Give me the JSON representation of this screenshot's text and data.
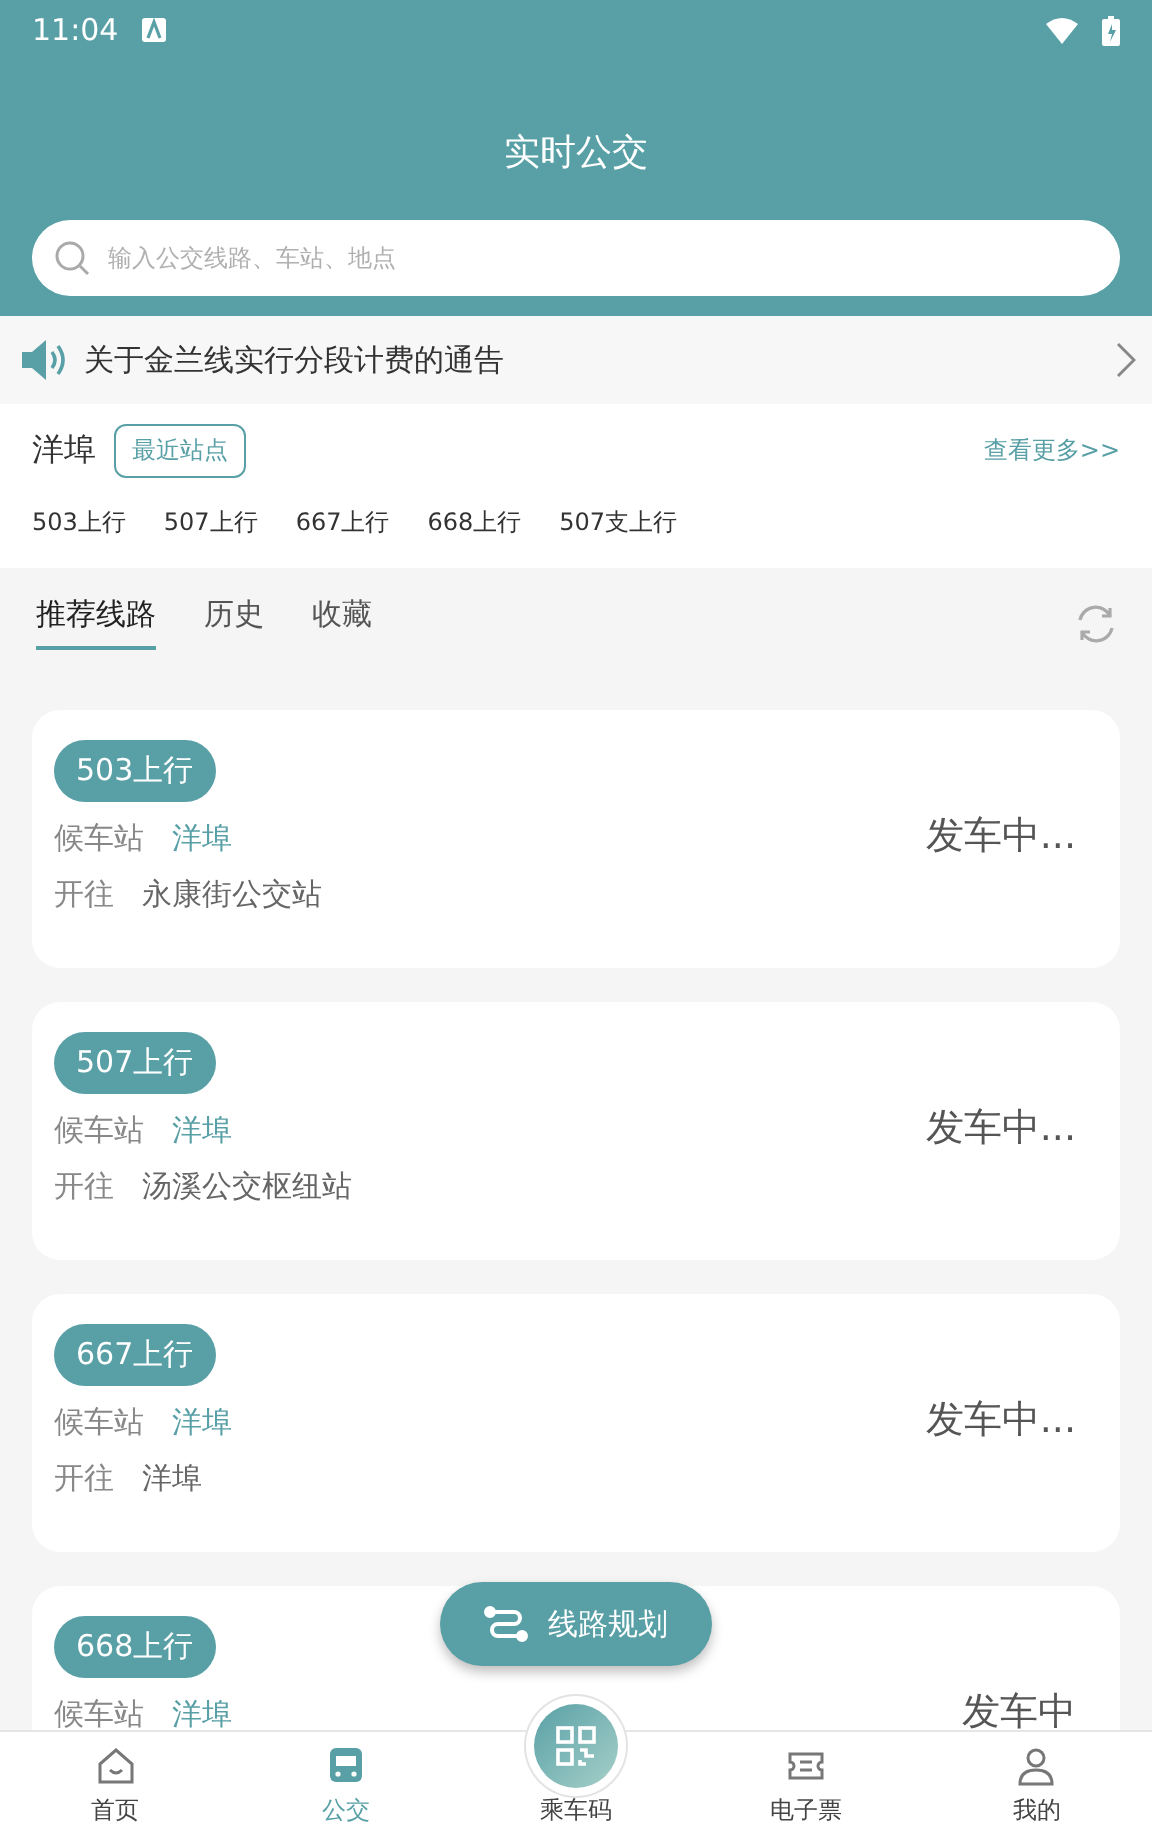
{
  "status_bar": {
    "time": "11:04"
  },
  "header": {
    "title": "实时公交",
    "search": {
      "placeholder": "输入公交线路、车站、地点"
    }
  },
  "notice": {
    "text": "关于金兰线实行分段计费的通告"
  },
  "nearby": {
    "station": "洋埠",
    "badge": "最近站点",
    "more": "查看更多>>",
    "routes": [
      "503上行",
      "507上行",
      "667上行",
      "668上行",
      "507支上行"
    ]
  },
  "tabs": [
    {
      "label": "推荐线路",
      "selected": true
    },
    {
      "label": "历史",
      "selected": false
    },
    {
      "label": "收藏",
      "selected": false
    }
  ],
  "cards": [
    {
      "route": "503上行",
      "wait_label": "候车站",
      "wait_station": "洋埠",
      "dest_label": "开往",
      "destination": "永康街公交站",
      "status": "发车中..."
    },
    {
      "route": "507上行",
      "wait_label": "候车站",
      "wait_station": "洋埠",
      "dest_label": "开往",
      "destination": "汤溪公交枢纽站",
      "status": "发车中..."
    },
    {
      "route": "667上行",
      "wait_label": "候车站",
      "wait_station": "洋埠",
      "dest_label": "开往",
      "destination": "洋埠",
      "status": "发车中..."
    },
    {
      "route": "668上行",
      "wait_label": "候车站",
      "wait_station": "洋埠",
      "status": "发车中"
    }
  ],
  "fab": {
    "label": "线路规划"
  },
  "nav": [
    {
      "kind": "home",
      "label": "首页",
      "selected": false
    },
    {
      "kind": "bus",
      "label": "公交",
      "selected": true
    },
    {
      "kind": "qr",
      "label": "乘车码",
      "selected": false
    },
    {
      "kind": "ticket",
      "label": "电子票",
      "selected": false
    },
    {
      "kind": "user",
      "label": "我的",
      "selected": false
    }
  ]
}
